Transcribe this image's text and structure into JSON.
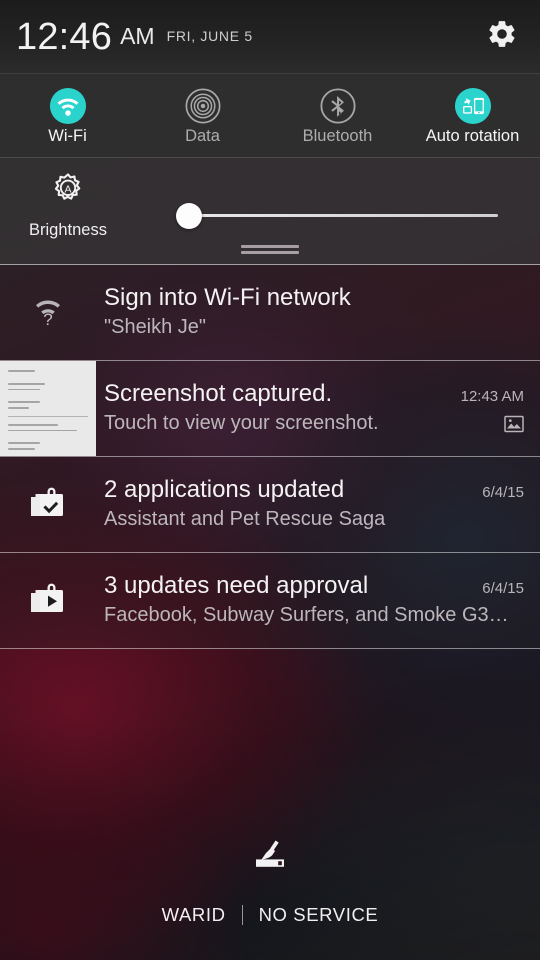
{
  "header": {
    "time": "12:46",
    "ampm": "AM",
    "date": "FRI, JUNE 5",
    "settings_icon": "gear-icon"
  },
  "quick_settings": {
    "accent_on_color": "#2ad4cd",
    "icon_off_color": "#a8a8a8",
    "tiles": [
      {
        "label": "Wi-Fi",
        "icon": "wifi-icon",
        "state": "on"
      },
      {
        "label": "Data",
        "icon": "mobile-data-icon",
        "state": "off"
      },
      {
        "label": "Bluetooth",
        "icon": "bluetooth-icon",
        "state": "off"
      },
      {
        "label": "Auto rotation",
        "icon": "auto-rotate-icon",
        "state": "on"
      }
    ]
  },
  "brightness": {
    "label": "Brightness",
    "icon": "auto-brightness-icon",
    "value_percent": 5
  },
  "notifications": [
    {
      "title": "Sign into Wi-Fi network",
      "subtitle": "\"Sheikh Je\"",
      "time": "",
      "icon": "wifi-question-icon",
      "small_icon": ""
    },
    {
      "title": "Screenshot captured.",
      "subtitle": "Touch to view your screenshot.",
      "time": "12:43 AM",
      "icon": "screenshot-thumbnail",
      "small_icon": "image-icon"
    },
    {
      "title": "2 applications updated",
      "subtitle": "Assistant and Pet Rescue Saga",
      "time": "6/4/15",
      "icon": "play-store-check-icon",
      "small_icon": ""
    },
    {
      "title": "3 updates need approval",
      "subtitle": "Facebook, Subway Surfers, and Smoke G3…",
      "time": "6/4/15",
      "icon": "play-store-update-icon",
      "small_icon": ""
    }
  ],
  "footer": {
    "clear_all_icon": "broom-icon",
    "carrier": "WARID",
    "service_status": "NO SERVICE"
  }
}
